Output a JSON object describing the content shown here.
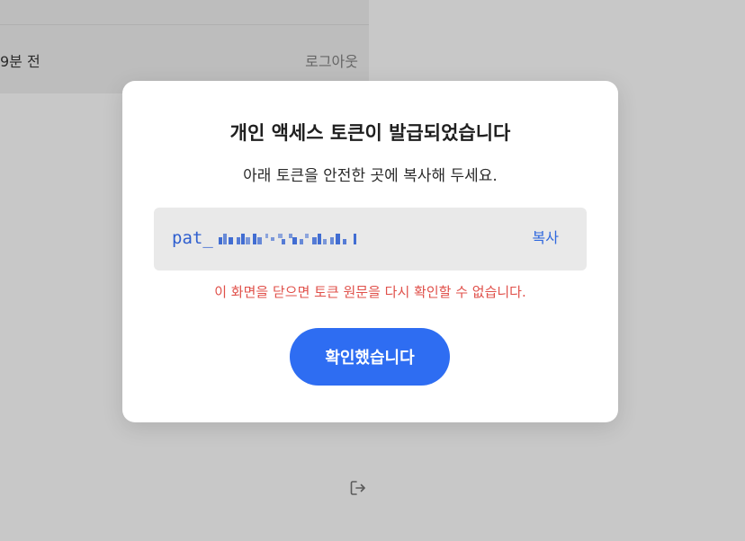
{
  "background": {
    "time_text": "9분 전",
    "logout_label": "로그아웃",
    "logout_icon": "logout-icon"
  },
  "modal": {
    "title": "개인 액세스 토큰이 발급되었습니다",
    "subtitle": "아래 토큰을 안전한 곳에 복사해 두세요.",
    "token_prefix": "pat_",
    "copy_label": "복사",
    "warning": "이 화면을 닫으면 토큰 원문을 다시 확인할 수 없습니다.",
    "confirm_label": "확인했습니다"
  },
  "colors": {
    "accent": "#2e6df2",
    "token_text": "#2f5fcf",
    "warning": "#e0504a",
    "overlay": "#c8c8c8"
  }
}
